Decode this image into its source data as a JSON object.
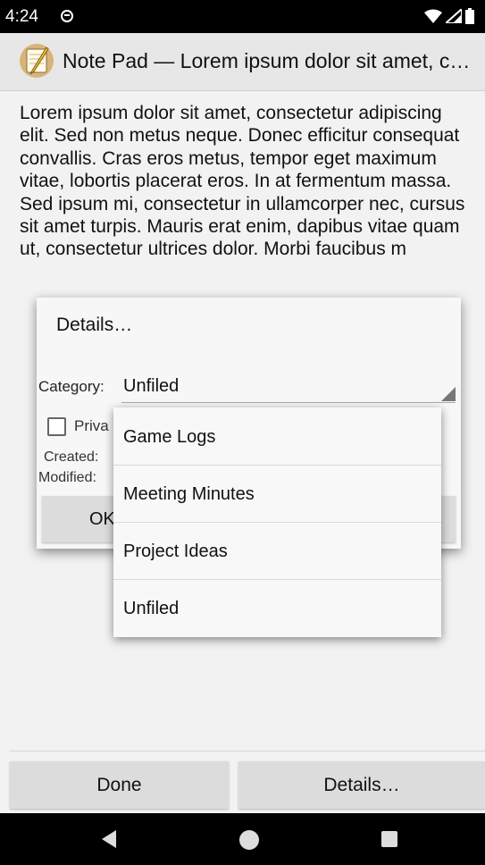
{
  "status_bar": {
    "time": "4:24",
    "icons": [
      "notification-icon",
      "wifi-icon",
      "signal-icon",
      "battery-icon"
    ]
  },
  "app_bar": {
    "title": "Note Pad — Lorem ipsum dolor sit amet, c…",
    "icon": "notepad-icon"
  },
  "note": {
    "text": "Lorem ipsum dolor sit amet, consectetur adipiscing elit.  Sed non metus neque.  Donec efficitur consequat convallis.  Cras eros metus, tempor eget maximum vitae, lobortis placerat eros.  In at fermentum massa.  Sed ipsum mi, consectetur in ullamcorper nec, cursus sit amet turpis.  Mauris erat enim, dapibus vitae quam ut, consectetur ultrices dolor.  Morbi faucibus m"
  },
  "dialog": {
    "title": "Details…",
    "category_label": "Category:",
    "category_value": "Unfiled",
    "private_label": "Priva",
    "created_label": "Created:",
    "modified_label": "Modified:",
    "ok_label": "OK"
  },
  "dropdown": {
    "options": [
      "Game Logs",
      "Meeting Minutes",
      "Project Ideas",
      "Unfiled"
    ]
  },
  "bottom_buttons": {
    "done": "Done",
    "details": "Details…"
  },
  "nav_bar": {
    "icons": [
      "back-icon",
      "home-icon",
      "recents-icon"
    ]
  }
}
